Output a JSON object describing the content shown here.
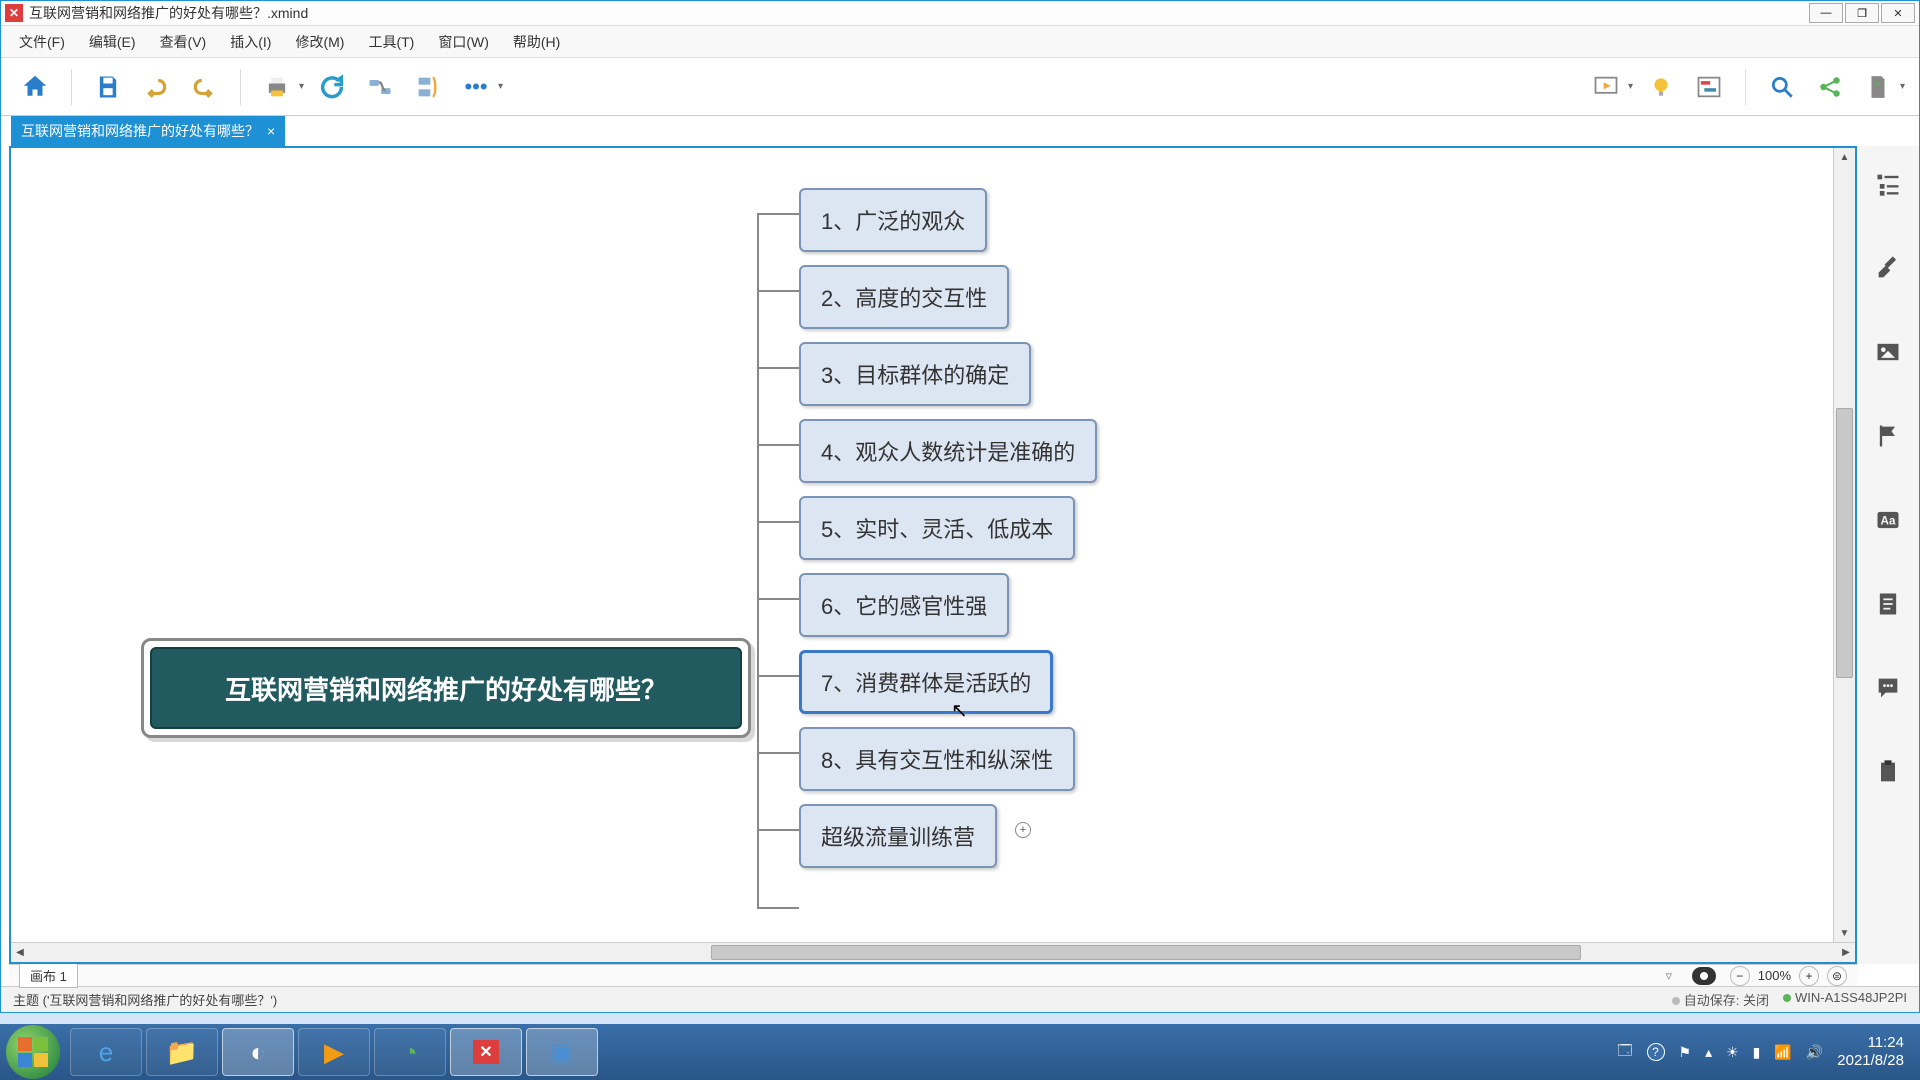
{
  "window": {
    "title": "互联网营销和网络推广的好处有哪些？.xmind"
  },
  "menu": {
    "file": "文件(F)",
    "edit": "编辑(E)",
    "view": "查看(V)",
    "insert": "插入(I)",
    "modify": "修改(M)",
    "tools": "工具(T)",
    "window": "窗口(W)",
    "help": "帮助(H)"
  },
  "tab": {
    "label": "互联网营销和网络推广的好处有哪些？"
  },
  "mindmap": {
    "central": "互联网营销和网络推广的好处有哪些？",
    "children": [
      "1、广泛的观众",
      "2、高度的交互性",
      "3、目标群体的确定",
      "4、观众人数统计是准确的",
      "5、实时、灵活、低成本",
      "6、它的感官性强",
      "7、消费群体是活跃的",
      "8、具有交互性和纵深性",
      "超级流量训练营"
    ],
    "selected_index": 6
  },
  "sheet": {
    "label": "画布 1"
  },
  "zoom": {
    "value": "100%"
  },
  "status": {
    "left": "主题 ('互联网营销和网络推广的好处有哪些？')",
    "autosave_label": "自动保存:",
    "autosave_value": "关闭",
    "host": "WIN-A1SS48JP2PI"
  },
  "tray": {
    "time": "11:24",
    "date": "2021/8/28"
  }
}
